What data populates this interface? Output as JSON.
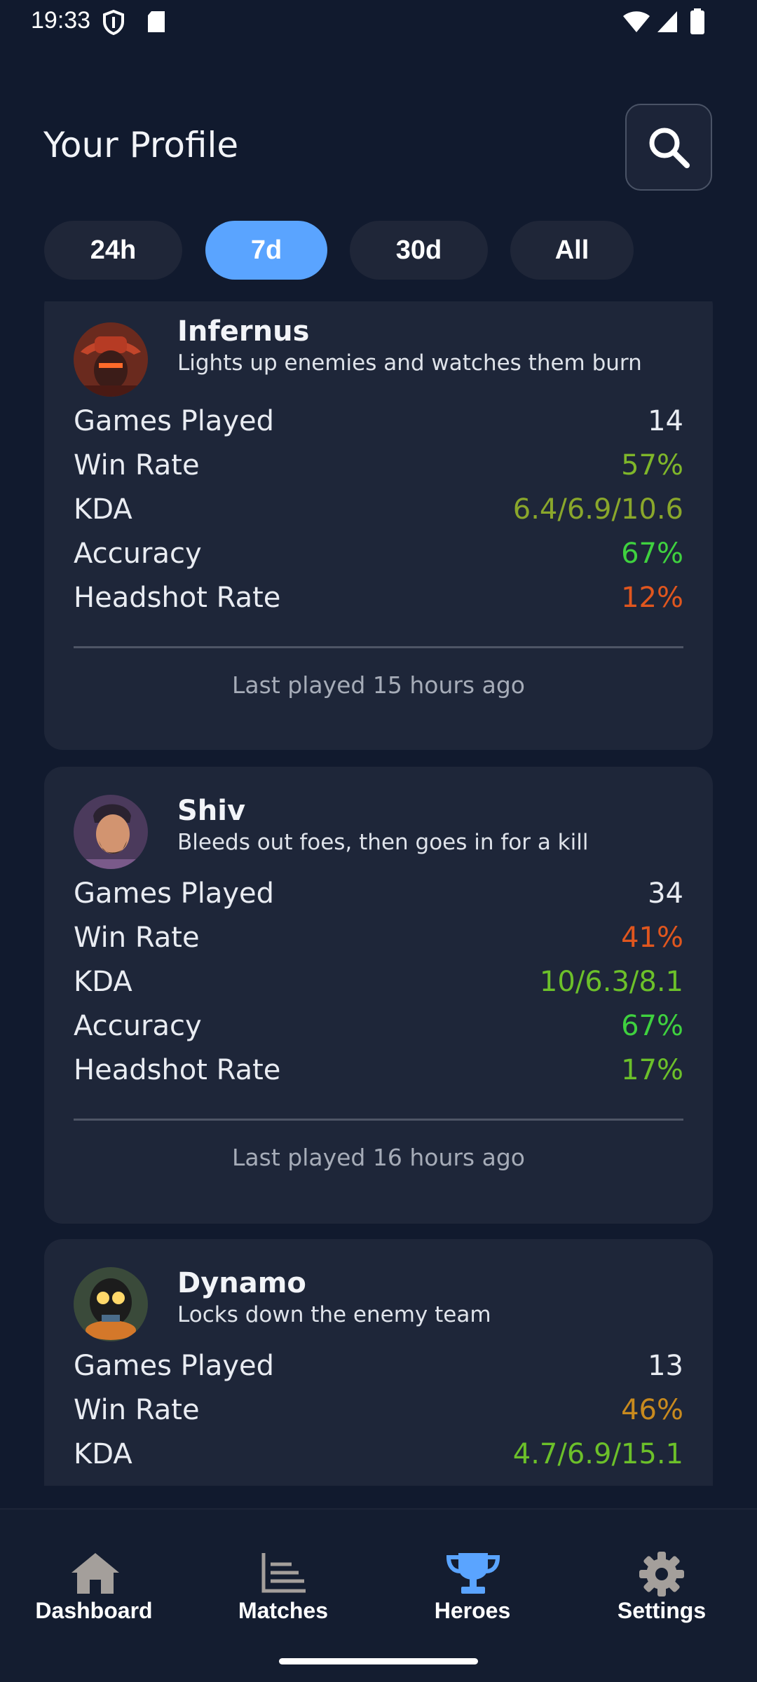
{
  "status_bar": {
    "time": "19:33"
  },
  "header": {
    "title": "Your Profile"
  },
  "filters": [
    {
      "label": "24h",
      "active": false
    },
    {
      "label": "7d",
      "active": true
    },
    {
      "label": "30d",
      "active": false
    },
    {
      "label": "All",
      "active": false
    }
  ],
  "colors": {
    "accent": "#5aa4ff",
    "good": "#3fd13f",
    "ok": "#7fb62a",
    "meh": "#c88a1e",
    "bad": "#e0561e"
  },
  "heroes": [
    {
      "name": "Infernus",
      "description": "Lights up enemies and watches them burn",
      "stats": [
        {
          "label": "Games Played",
          "value": "14"
        },
        {
          "label": "Win Rate",
          "value": "57%"
        },
        {
          "label": "KDA",
          "value": "6.4/6.9/10.6"
        },
        {
          "label": "Accuracy",
          "value": "67%"
        },
        {
          "label": "Headshot Rate",
          "value": "12%"
        }
      ],
      "last_played": "Last played 15 hours ago"
    },
    {
      "name": "Shiv",
      "description": "Bleeds out foes, then goes in for a kill",
      "stats": [
        {
          "label": "Games Played",
          "value": "34"
        },
        {
          "label": "Win Rate",
          "value": "41%"
        },
        {
          "label": "KDA",
          "value": "10/6.3/8.1"
        },
        {
          "label": "Accuracy",
          "value": "67%"
        },
        {
          "label": "Headshot Rate",
          "value": "17%"
        }
      ],
      "last_played": "Last played 16 hours ago"
    },
    {
      "name": "Dynamo",
      "description": "Locks down the enemy team",
      "stats": [
        {
          "label": "Games Played",
          "value": "13"
        },
        {
          "label": "Win Rate",
          "value": "46%"
        },
        {
          "label": "KDA",
          "value": "4.7/6.9/15.1"
        }
      ]
    }
  ],
  "nav": [
    {
      "label": "Dashboard",
      "icon": "home-icon"
    },
    {
      "label": "Matches",
      "icon": "chart-icon"
    },
    {
      "label": "Heroes",
      "icon": "trophy-icon",
      "active": true
    },
    {
      "label": "Settings",
      "icon": "gear-icon"
    }
  ]
}
